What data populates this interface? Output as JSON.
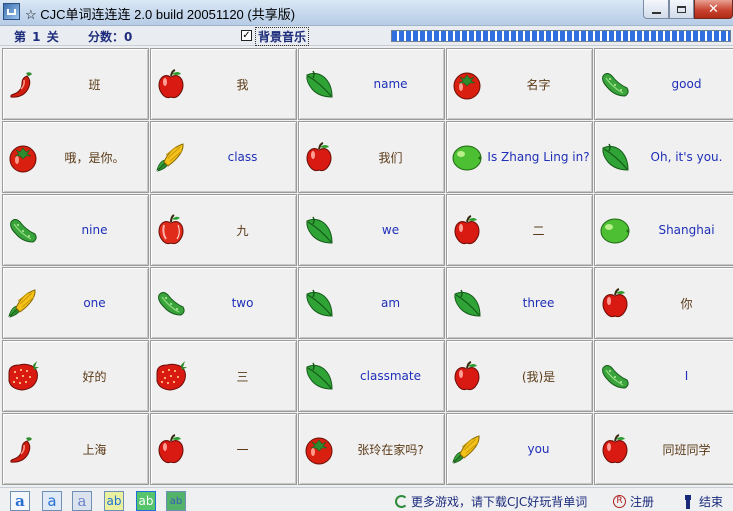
{
  "window": {
    "title": "☆ CJC单词连连连 2.0 build 20051120 (共享版)"
  },
  "status": {
    "level": "第 1 关",
    "score": "分数：0",
    "music_label": "背景音乐",
    "music_checked": true,
    "progress_fraction": 1.0
  },
  "colors": {
    "english_text": "#1f2fb8",
    "chinese_text": "#5a3a17",
    "progress": "#2f6fe0"
  },
  "tiles": [
    {
      "icon": "chili-pepper-icon",
      "word": "班",
      "lang": "cn"
    },
    {
      "icon": "red-apple-icon",
      "word": "我",
      "lang": "cn"
    },
    {
      "icon": "green-leaf-icon",
      "word": "name",
      "lang": "en"
    },
    {
      "icon": "tomato-icon",
      "word": "名字",
      "lang": "cn"
    },
    {
      "icon": "cucumber-icon",
      "word": "good",
      "lang": "en"
    },
    {
      "icon": "tomato-icon",
      "word": "哦，是你。",
      "lang": "cn"
    },
    {
      "icon": "corn-icon",
      "word": "class",
      "lang": "en"
    },
    {
      "icon": "red-apple-icon",
      "word": "我们",
      "lang": "cn"
    },
    {
      "icon": "lime-icon",
      "word": "Is Zhang Ling in?",
      "lang": "en"
    },
    {
      "icon": "green-leaf-icon",
      "word": "Oh, it's you.",
      "lang": "en"
    },
    {
      "icon": "cucumber-icon",
      "word": "nine",
      "lang": "en"
    },
    {
      "icon": "apple-icon",
      "word": "九",
      "lang": "cn"
    },
    {
      "icon": "green-leaf-icon",
      "word": "we",
      "lang": "en"
    },
    {
      "icon": "red-apple-icon",
      "word": "二",
      "lang": "cn"
    },
    {
      "icon": "lime-icon",
      "word": "Shanghai",
      "lang": "en"
    },
    {
      "icon": "corn-icon",
      "word": "one",
      "lang": "en"
    },
    {
      "icon": "cucumber-icon",
      "word": "two",
      "lang": "en"
    },
    {
      "icon": "green-leaf-icon",
      "word": "am",
      "lang": "en"
    },
    {
      "icon": "green-leaf-icon",
      "word": "three",
      "lang": "en"
    },
    {
      "icon": "red-apple-icon",
      "word": "你",
      "lang": "cn"
    },
    {
      "icon": "strawberry-icon",
      "word": "好的",
      "lang": "cn"
    },
    {
      "icon": "strawberry-icon",
      "word": "三",
      "lang": "cn"
    },
    {
      "icon": "green-leaf-icon",
      "word": "classmate",
      "lang": "en"
    },
    {
      "icon": "red-apple-icon",
      "word": "(我)是",
      "lang": "cn"
    },
    {
      "icon": "cucumber-icon",
      "word": "I",
      "lang": "en"
    },
    {
      "icon": "chili-pepper-icon",
      "word": "上海",
      "lang": "cn"
    },
    {
      "icon": "red-apple-icon",
      "word": "一",
      "lang": "cn"
    },
    {
      "icon": "tomato-icon",
      "word": "张玲在家吗?",
      "lang": "cn"
    },
    {
      "icon": "corn-icon",
      "word": "you",
      "lang": "en"
    },
    {
      "icon": "red-apple-icon",
      "word": "同班同学",
      "lang": "cn"
    }
  ],
  "bottom": {
    "font_buttons": [
      "a",
      "a",
      "a",
      "ab",
      "ab",
      "ab"
    ],
    "more_games": "更多游戏，请下载CJC好玩背单词",
    "register": "注册",
    "quit": "结束"
  }
}
